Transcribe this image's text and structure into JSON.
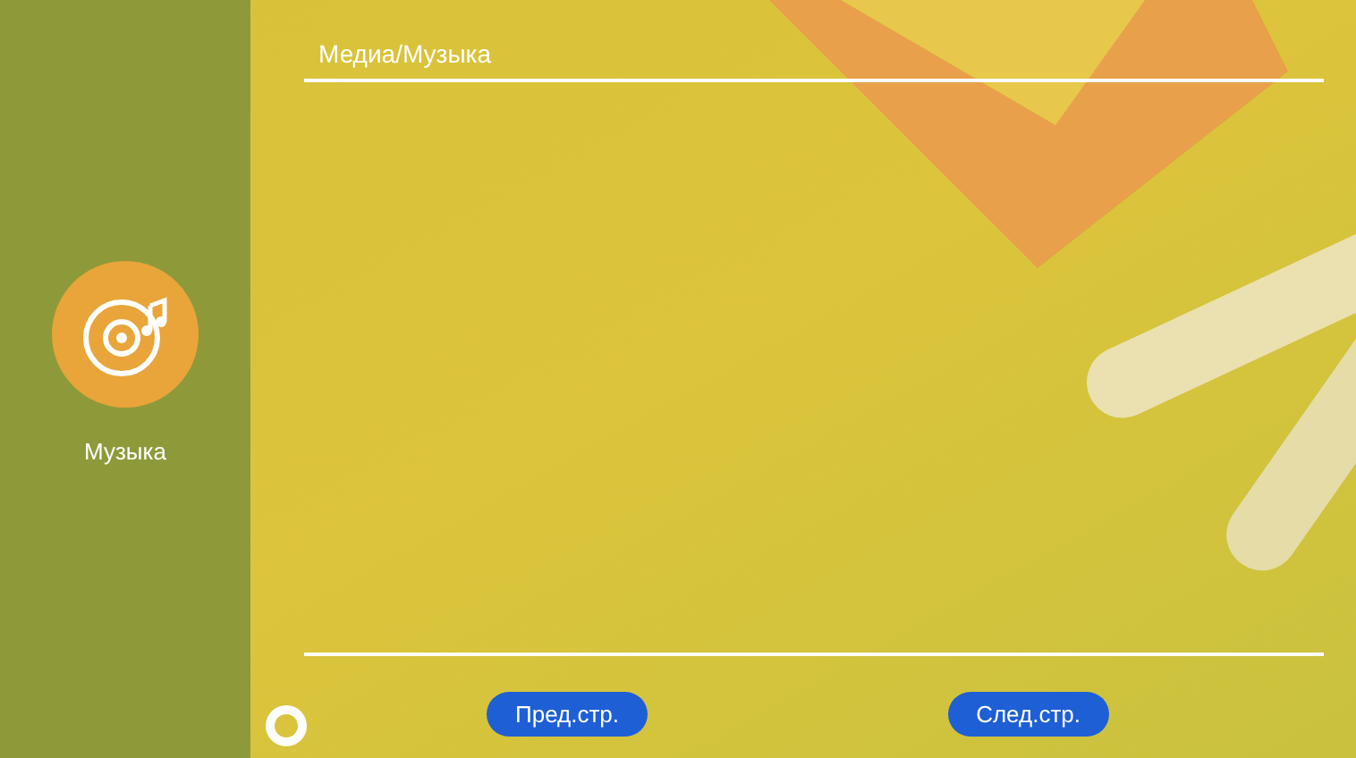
{
  "breadcrumb": "Медиа/Музыка",
  "sidebar": {
    "items": [
      {
        "label": "Музыка"
      }
    ]
  },
  "buttons": [
    {
      "label": "Пред.стр."
    },
    {
      "label": "След.стр."
    }
  ]
}
